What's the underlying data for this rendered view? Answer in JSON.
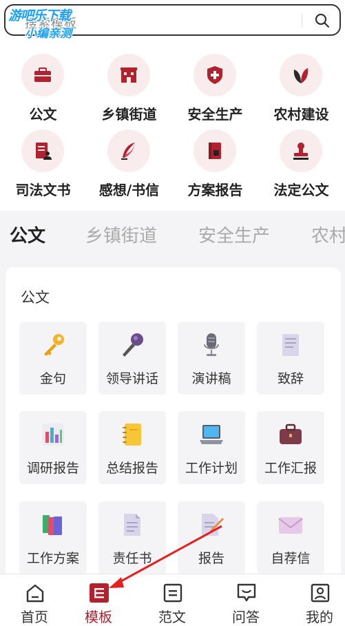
{
  "search": {
    "placeholder": "搜索模板"
  },
  "watermark": {
    "line1": "游吧乐下载",
    "line2": "小编亲测"
  },
  "categories": [
    {
      "label": "公文",
      "icon": "briefcase-icon"
    },
    {
      "label": "乡镇街道",
      "icon": "building-icon"
    },
    {
      "label": "安全生产",
      "icon": "shield-plus-icon"
    },
    {
      "label": "农村建设",
      "icon": "leaf-icon"
    },
    {
      "label": "司法文书",
      "icon": "document-person-icon"
    },
    {
      "label": "感想/书信",
      "icon": "quill-icon"
    },
    {
      "label": "方案报告",
      "icon": "book-icon"
    },
    {
      "label": "法定公文",
      "icon": "stamp-icon"
    }
  ],
  "tabs": [
    {
      "label": "公文",
      "active": true
    },
    {
      "label": "乡镇街道",
      "active": false
    },
    {
      "label": "安全生产",
      "active": false
    },
    {
      "label": "农村建设",
      "active": false
    }
  ],
  "section": {
    "title": "公文",
    "items": [
      {
        "label": "金句",
        "icon": "key-icon"
      },
      {
        "label": "领导讲话",
        "icon": "microphone-icon"
      },
      {
        "label": "演讲稿",
        "icon": "podcast-mic-icon"
      },
      {
        "label": "致辞",
        "icon": "scroll-icon"
      },
      {
        "label": "调研报告",
        "icon": "bar-chart-icon"
      },
      {
        "label": "总结报告",
        "icon": "notebook-icon"
      },
      {
        "label": "工作计划",
        "icon": "laptop-icon"
      },
      {
        "label": "工作汇报",
        "icon": "briefcase-icon"
      },
      {
        "label": "工作方案",
        "icon": "books-icon"
      },
      {
        "label": "责任书",
        "icon": "document-icon"
      },
      {
        "label": "报告",
        "icon": "document-pencil-icon"
      },
      {
        "label": "自荐信",
        "icon": "envelope-icon"
      }
    ]
  },
  "nav": [
    {
      "label": "首页",
      "icon": "home-icon",
      "active": false
    },
    {
      "label": "模板",
      "icon": "template-icon",
      "active": true
    },
    {
      "label": "范文",
      "icon": "article-icon",
      "active": false
    },
    {
      "label": "问答",
      "icon": "chat-icon",
      "active": false
    },
    {
      "label": "我的",
      "icon": "profile-icon",
      "active": false
    }
  ],
  "colors": {
    "brand": "#b1222e",
    "brand_light": "#f9eced",
    "annotation": "#e52020"
  }
}
